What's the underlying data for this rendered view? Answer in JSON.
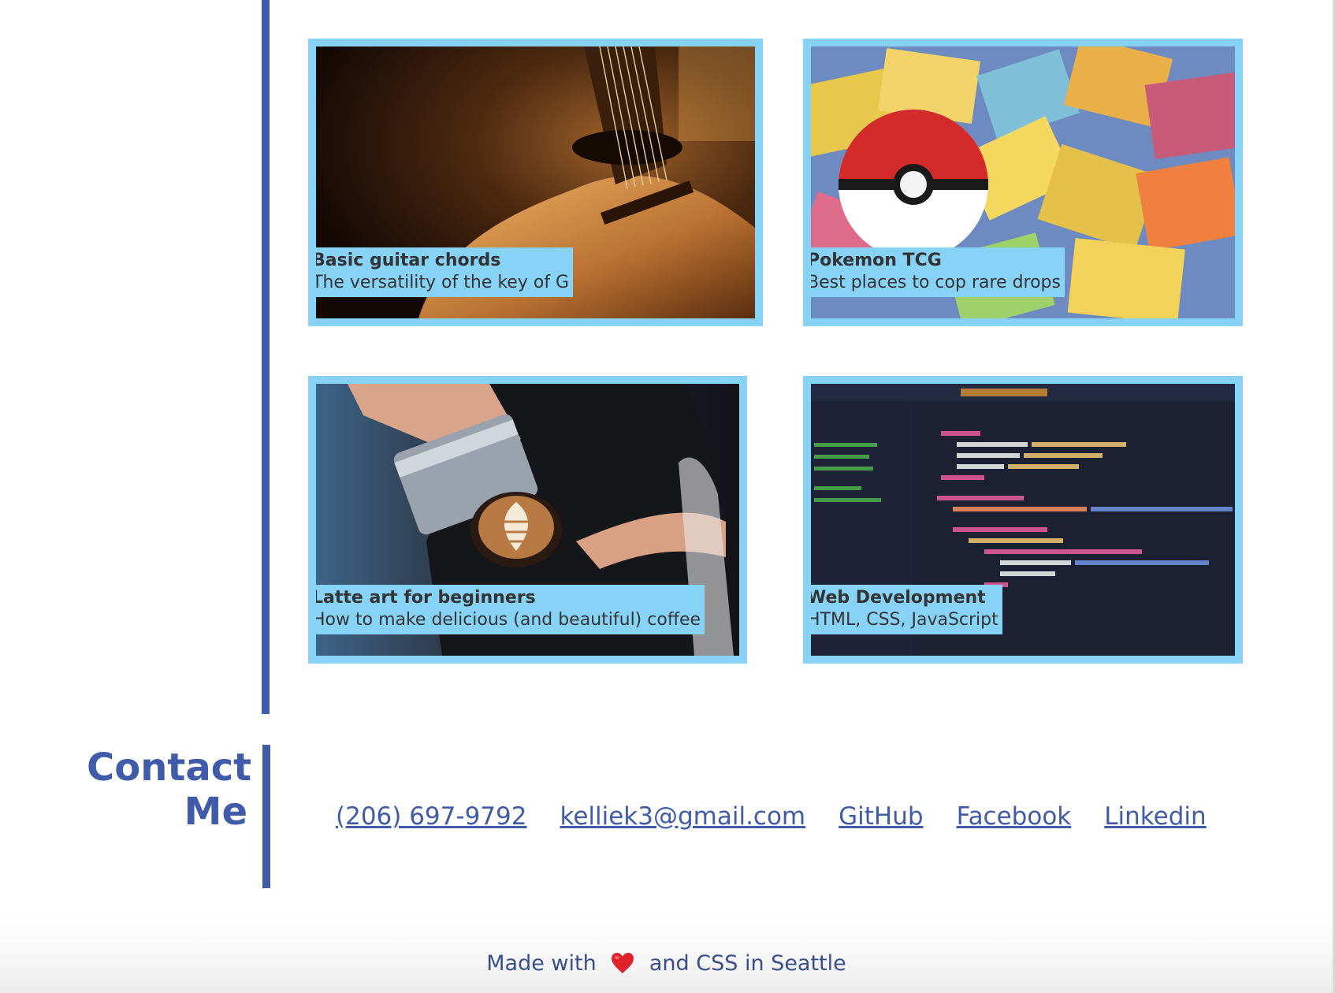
{
  "projects": [
    {
      "title": "Basic guitar chords",
      "subtitle": "The versatility of the key of G",
      "image_icon": "guitar-photo"
    },
    {
      "title": "Pokemon TCG",
      "subtitle": "Best places to cop rare drops",
      "image_icon": "pokeball-cards-photo"
    },
    {
      "title": "Latte art for beginners",
      "subtitle": "How to make delicious (and beautiful) coffee",
      "image_icon": "latte-art-photo"
    },
    {
      "title": "Web Development",
      "subtitle": "HTML, CSS, JavaScript",
      "image_icon": "code-editor-photo"
    }
  ],
  "contact": {
    "heading_line1": "Contact",
    "heading_line2": "Me",
    "links": [
      {
        "label": "(206) 697-9792"
      },
      {
        "label": "kelliek3@gmail.com"
      },
      {
        "label": "GitHub"
      },
      {
        "label": "Facebook"
      },
      {
        "label": "Linkedin"
      }
    ]
  },
  "footer": {
    "text_before": "Made with",
    "heart_icon": "heart-icon",
    "text_after": "and CSS in Seattle"
  },
  "colors": {
    "accent_blue": "#3f5ba9",
    "card_border": "#87d3f8",
    "heart_red": "#e0232b"
  }
}
